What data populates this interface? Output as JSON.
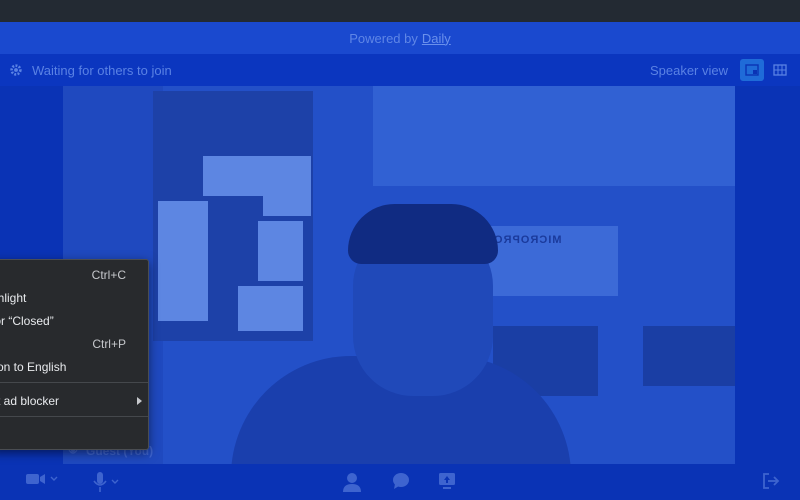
{
  "banner": {
    "prefix": "Powered by",
    "link": "Daily"
  },
  "header": {
    "status": "Waiting for others to join",
    "view_label": "Speaker view",
    "icons": [
      "gear-icon",
      "speaker-view-icon",
      "grid-view-icon"
    ]
  },
  "video": {
    "sign_text": "MICROPRO"
  },
  "participant": {
    "name": "Guest (You)"
  },
  "toolbar": {
    "icons": [
      "camera-icon",
      "microphone-icon",
      "people-icon",
      "chat-icon",
      "screen-share-icon",
      "leave-icon"
    ]
  },
  "context_menu": {
    "items": [
      {
        "label": "",
        "shortcut": "Ctrl+C"
      },
      {
        "label": "ghlight",
        "shortcut": ""
      },
      {
        "label": "for “Closed”",
        "shortcut": ""
      },
      {
        "label": "",
        "shortcut": "Ctrl+P"
      },
      {
        "label": "tion to English",
        "shortcut": ""
      },
      {
        "label": "st ad blocker",
        "shortcut": ""
      }
    ]
  },
  "colors": {
    "accent": "#1f6bd8",
    "background": "#0b34b8",
    "menu_bg": "#282a2d"
  }
}
